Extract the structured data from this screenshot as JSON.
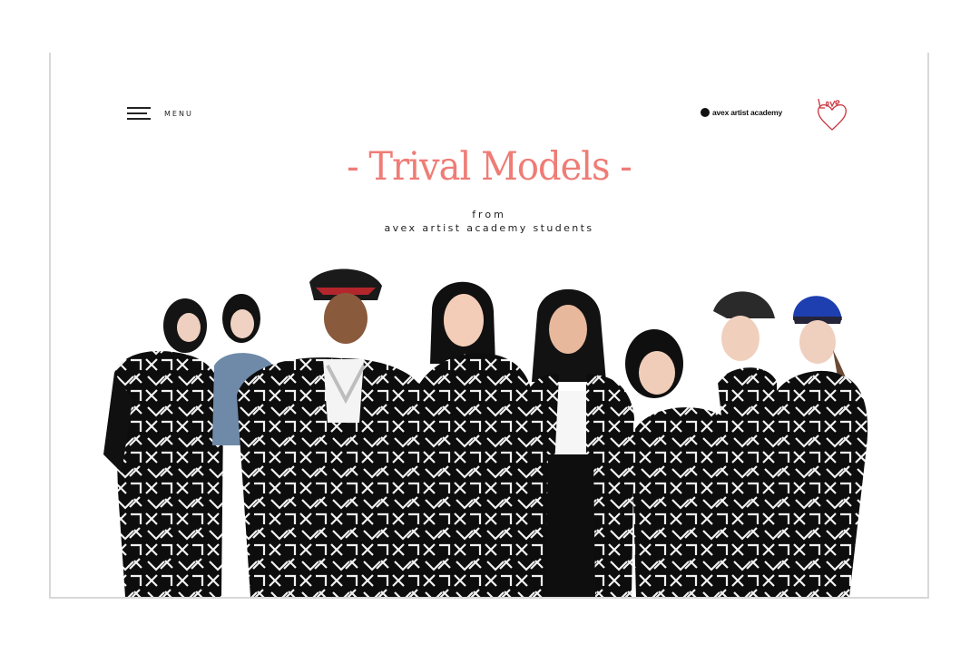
{
  "header": {
    "menu_label": "MENU",
    "brand_name": "avex artist academy",
    "love_logo_text": "Love"
  },
  "hero": {
    "title": "- Trival Models -",
    "from_text": "from",
    "subtitle": "avex artist academy students"
  },
  "photo": {
    "alt": "group of eight students in black and white patterned outfits"
  },
  "colors": {
    "accent": "#ef7c76",
    "text": "#222222",
    "window_bar": "#d6d6d6"
  }
}
